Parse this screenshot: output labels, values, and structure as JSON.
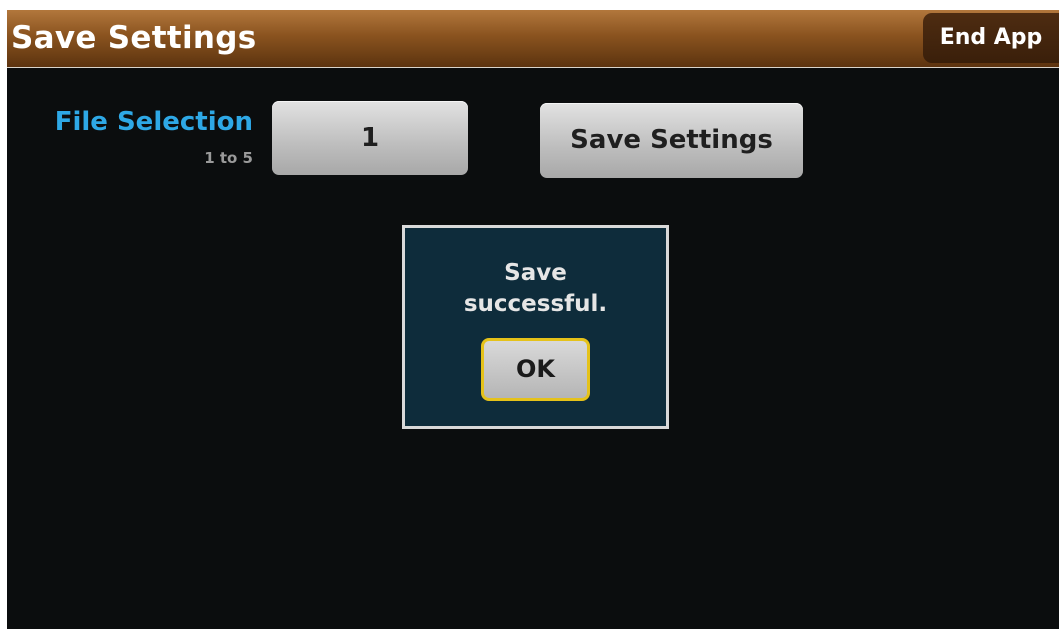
{
  "header": {
    "title": "Save Settings",
    "end_app_label": "End App"
  },
  "file_selection": {
    "label": "File Selection",
    "range": "1 to 5",
    "value": "1"
  },
  "actions": {
    "save_label": "Save Settings"
  },
  "dialog": {
    "message": "Save\nsuccessful.",
    "ok_label": "OK"
  },
  "colors": {
    "title_bar": "#8a531f",
    "label_accent": "#2ea8e6",
    "dialog_background": "#0e2c3b",
    "ok_focus_border": "#e5c21a"
  }
}
